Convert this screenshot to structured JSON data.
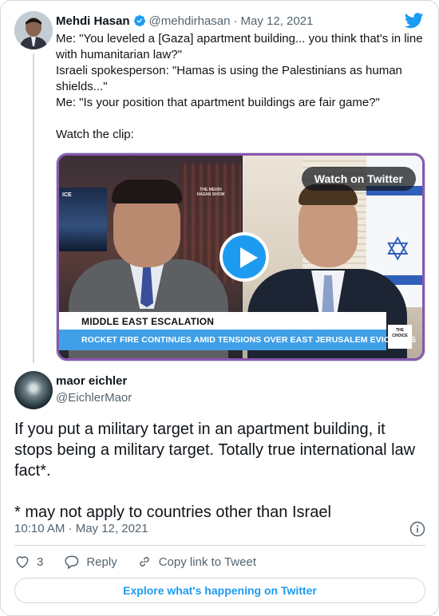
{
  "parent": {
    "name": "Mehdi Hasan",
    "handle": "@mehdirhasan",
    "separator": "·",
    "date": "May 12, 2021",
    "text_lines": [
      "Me: \"You leveled a [Gaza] apartment building... you think that's in line",
      "with humanitarian law?\"",
      "Israeli spokesperson: \"Hamas is using the Palestinians as human",
      "shields...\"",
      "Me: \"Is your position that apartment buildings are fair game?\"",
      "",
      "Watch the clip:"
    ],
    "media": {
      "watch_label": "Watch on Twitter",
      "lower_third": "MIDDLE EAST ESCALATION",
      "ticker": "ROCKET FIRE CONTINUES AMID TENSIONS OVER EAST JERUSALEM EVICTIONS",
      "corner_text": "ICE",
      "show_logo": "THE MEHDI HASAN SHOW",
      "channel_logo": "THE CHOICE"
    }
  },
  "reply": {
    "name": "maor eichler",
    "handle": "@EichlerMaor",
    "text_lines": [
      "If you put a military target in an apartment building, it",
      "stops being a military target. Totally true international law",
      "fact*.",
      "",
      "* may not apply to countries other than Israel"
    ],
    "timestamp": "10:10 AM · May 12, 2021"
  },
  "actions": {
    "like_count": "3",
    "reply_label": "Reply",
    "copy_label": "Copy link to Tweet"
  },
  "explore_label": "Explore what's happening on Twitter",
  "colors": {
    "accent": "#1d9bf0",
    "text": "#0f1419",
    "secondary": "#536471",
    "border": "#cfd9de"
  },
  "icons": [
    "verified-badge-icon",
    "twitter-bird-icon",
    "play-icon",
    "info-icon",
    "heart-icon",
    "reply-bubble-icon",
    "link-icon"
  ]
}
